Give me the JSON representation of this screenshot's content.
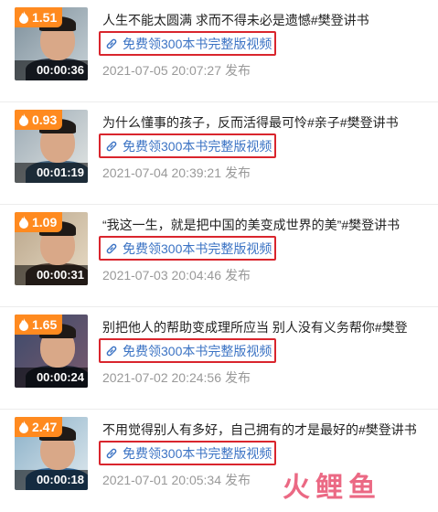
{
  "items": [
    {
      "heat": "1.51",
      "duration": "00:00:36",
      "title": "人生不能太圆满 求而不得未必是遗憾#樊登讲书",
      "link": "免费领300本书完整版视频",
      "date": "2021-07-05 20:07:27",
      "publish": "发布"
    },
    {
      "heat": "0.93",
      "duration": "00:01:19",
      "title": "为什么懂事的孩子，反而活得最可怜#亲子#樊登讲书",
      "link": "免费领300本书完整版视频",
      "date": "2021-07-04 20:39:21",
      "publish": "发布"
    },
    {
      "heat": "1.09",
      "duration": "00:00:31",
      "title": "“我这一生，就是把中国的美变成世界的美”#樊登讲书",
      "link": "免费领300本书完整版视频",
      "date": "2021-07-03 20:04:46",
      "publish": "发布"
    },
    {
      "heat": "1.65",
      "duration": "00:00:24",
      "title": "别把他人的帮助变成理所应当 别人没有义务帮你#樊登",
      "link": "免费领300本书完整版视频",
      "date": "2021-07-02 20:24:56",
      "publish": "发布"
    },
    {
      "heat": "2.47",
      "duration": "00:00:18",
      "title": "不用觉得别人有多好，自己拥有的才是最好的#樊登讲书",
      "link": "免费领300本书完整版视频",
      "date": "2021-07-01 20:05:34",
      "publish": "发布"
    }
  ],
  "watermark": "火鲤鱼",
  "colors": {
    "heat_badge": "#ff8a1f",
    "link": "#3b73c4",
    "highlight_border": "#d9252d",
    "date": "#999999",
    "watermark": "#e8506f"
  }
}
